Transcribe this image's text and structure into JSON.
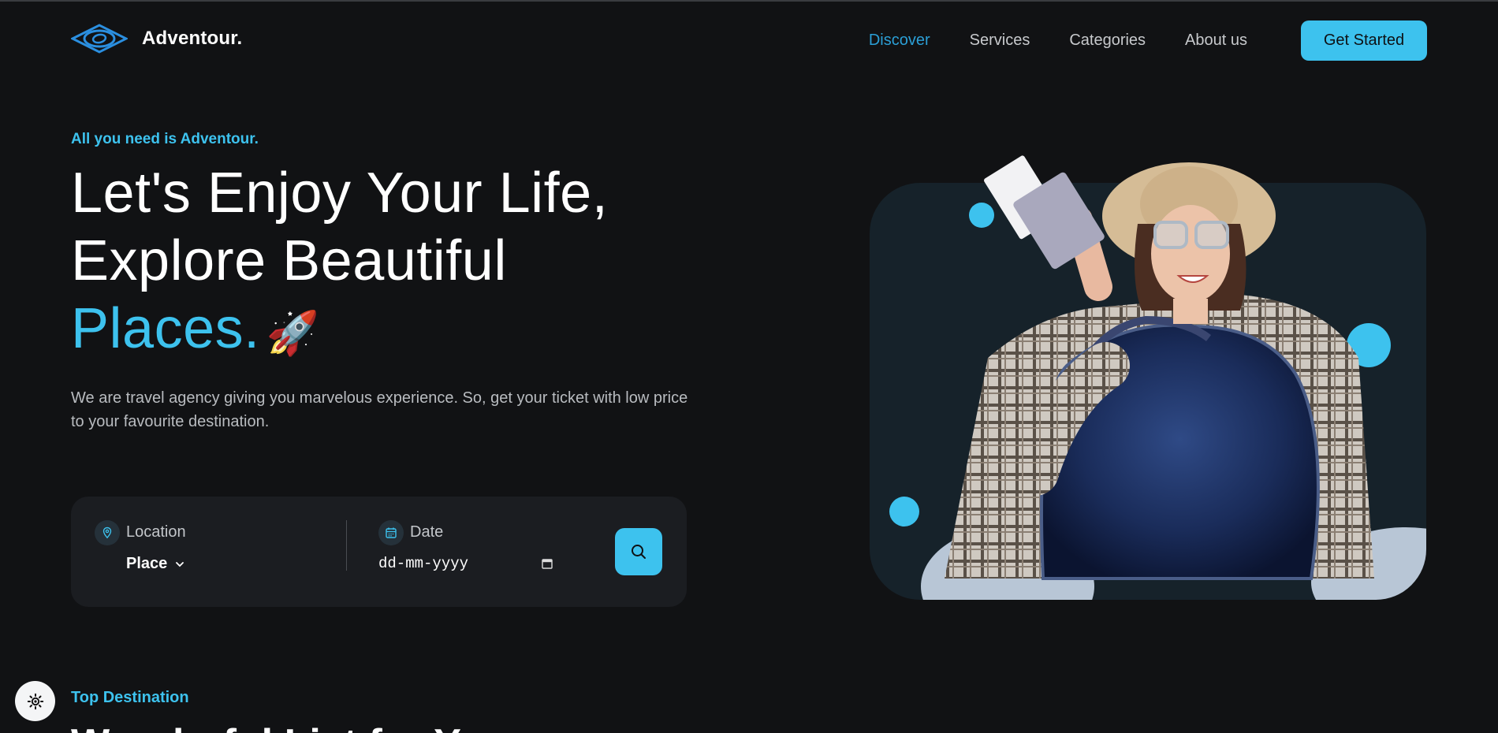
{
  "brand": {
    "name": "Adventour."
  },
  "nav": {
    "items": [
      {
        "label": "Discover",
        "active": true
      },
      {
        "label": "Services",
        "active": false
      },
      {
        "label": "Categories",
        "active": false
      },
      {
        "label": "About us",
        "active": false
      }
    ],
    "cta_label": "Get Started"
  },
  "hero": {
    "eyebrow": "All you need is Adventour.",
    "headline_line1": "Let's Enjoy Your Life,",
    "headline_line2": "Explore Beautiful",
    "headline_accent": "Places.",
    "headline_emoji": "🚀",
    "description": "We are travel agency giving you marvelous experience. So, get your ticket with low price to your favourite destination."
  },
  "search": {
    "location_label": "Location",
    "location_value": "Place",
    "date_label": "Date",
    "date_placeholder": "dd-mm-yyyy"
  },
  "section": {
    "tag": "Top Destination",
    "title": "Wonderful List for You"
  },
  "icons": {
    "logo": "eye-diamond-logo-icon",
    "location": "map-pin-icon",
    "date": "calendar-icon",
    "search": "search-icon",
    "theme": "sun-icon"
  },
  "colors": {
    "background": "#111214",
    "accent": "#3dc2ee",
    "nav_active": "#2b9fd6",
    "panel": "#1b1d21",
    "image_card": "#16222a"
  }
}
